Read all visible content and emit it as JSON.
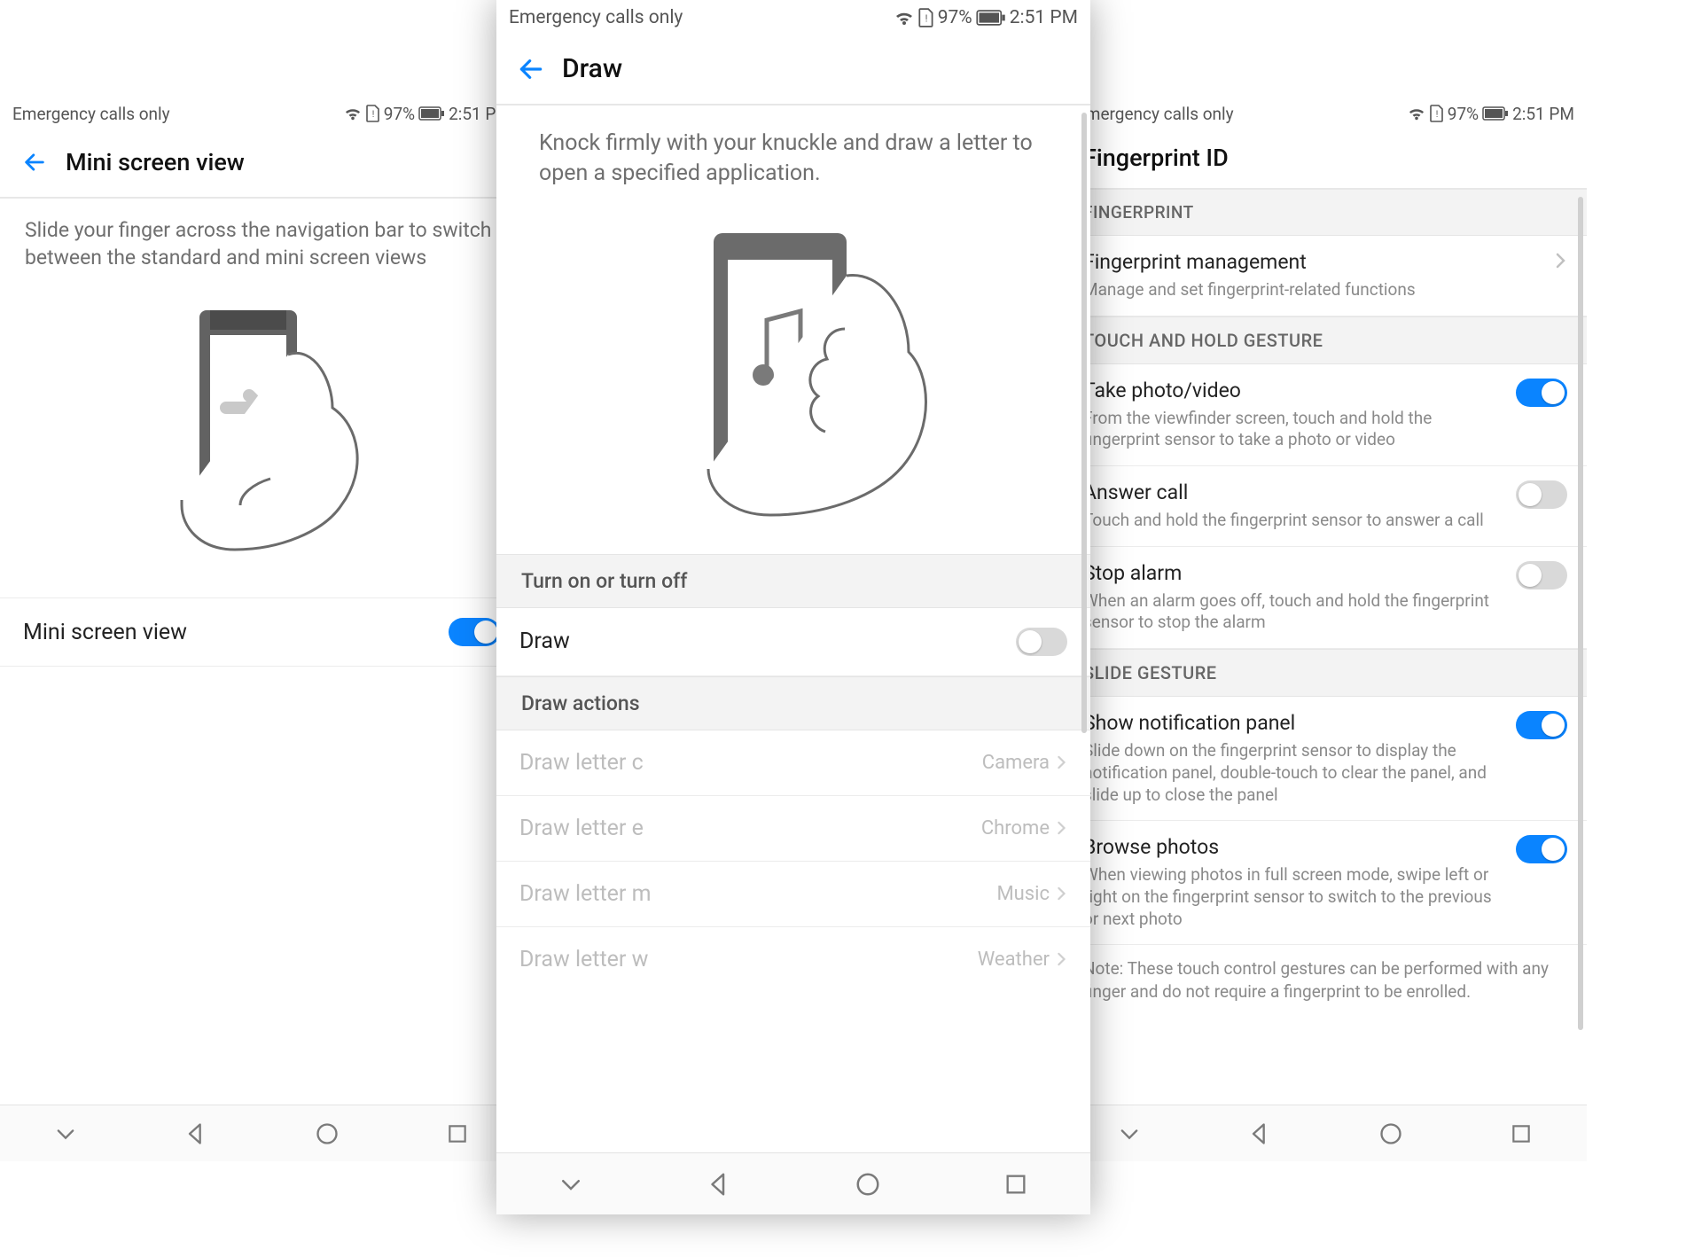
{
  "status": {
    "carrier": "Emergency calls only",
    "battery_percent": "97%",
    "time": "2:51 PM"
  },
  "left": {
    "title": "Mini screen view",
    "description": "Slide your finger across the navigation bar to switch between the standard and mini screen views",
    "toggle_label": "Mini screen view",
    "toggle_on": true
  },
  "center": {
    "title": "Draw",
    "description": "Knock firmly with your knuckle and draw a letter to open a specified application.",
    "section_toggle": "Turn on or turn off",
    "draw_label": "Draw",
    "draw_on": false,
    "section_actions": "Draw actions",
    "actions": [
      {
        "label": "Draw letter c",
        "value": "Camera"
      },
      {
        "label": "Draw letter e",
        "value": "Chrome"
      },
      {
        "label": "Draw letter m",
        "value": "Music"
      },
      {
        "label": "Draw letter w",
        "value": "Weather"
      }
    ]
  },
  "right": {
    "title": "Fingerprint ID",
    "section_fp": "Fingerprint",
    "fp_mgmt_label": "Fingerprint management",
    "fp_mgmt_sub": "Manage and set fingerprint-related functions",
    "section_touch": "Touch and hold gesture",
    "touch_items": [
      {
        "label": "Take photo/video",
        "sub": "From the viewfinder screen, touch and hold the fingerprint sensor to take a photo or video",
        "on": true
      },
      {
        "label": "Answer call",
        "sub": "Touch and hold the fingerprint sensor to answer a call",
        "on": false
      },
      {
        "label": "Stop alarm",
        "sub": "When an alarm goes off, touch and hold the fingerprint sensor to stop the alarm",
        "on": false
      }
    ],
    "section_slide": "Slide gesture",
    "slide_items": [
      {
        "label": "Show notification panel",
        "sub": "Slide down on the fingerprint sensor to display the notification panel, double-touch to clear the panel, and slide up to close the panel",
        "on": true
      },
      {
        "label": "Browse photos",
        "sub": "When viewing photos in full screen mode, swipe left or right on the fingerprint sensor to switch to the previous or next photo",
        "on": true
      }
    ],
    "note": "Note: These touch control gestures can be performed with any finger and do not require a fingerprint to be enrolled."
  }
}
